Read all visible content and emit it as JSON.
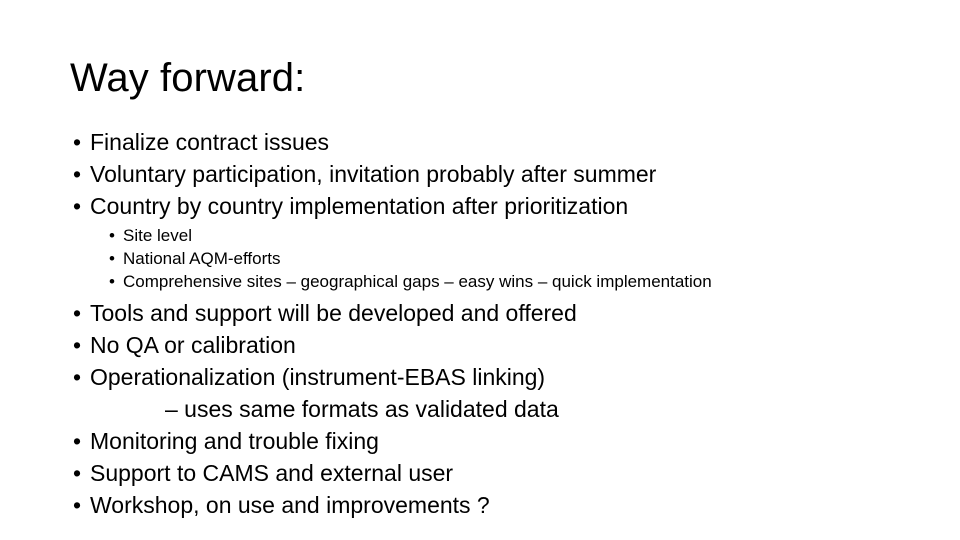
{
  "slide": {
    "title": "Way forward:",
    "background_color": "#FFFFFF",
    "text_color": "#000000",
    "bullet_glyph": "•",
    "content": [
      {
        "level": 1,
        "text": "Finalize contract issues"
      },
      {
        "level": 1,
        "text": "Voluntary participation, invitation probably after summer"
      },
      {
        "level": 1,
        "text": "Country by country implementation after prioritization"
      },
      {
        "level": 2,
        "text": "Site level"
      },
      {
        "level": 2,
        "text": "National AQM-efforts"
      },
      {
        "level": 2,
        "text": "Comprehensive sites – geographical gaps – easy wins – quick implementation"
      },
      {
        "level": 1,
        "text": "Tools and support will be developed and offered"
      },
      {
        "level": 1,
        "text": "No QA or calibration"
      },
      {
        "level": 1,
        "text": "Operationalization (instrument-EBAS linking)"
      },
      {
        "level": 0,
        "text": "– uses same formats as validated data"
      },
      {
        "level": 1,
        "text": "Monitoring and trouble fixing"
      },
      {
        "level": 1,
        "text": "Support to CAMS and external user"
      },
      {
        "level": 1,
        "text": "Workshop, on use and improvements ?"
      }
    ]
  }
}
